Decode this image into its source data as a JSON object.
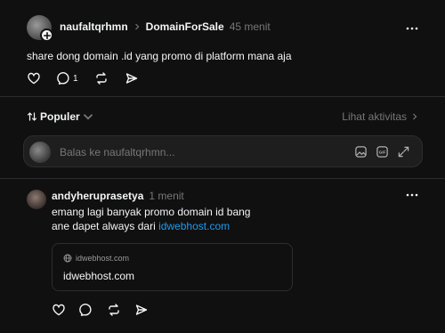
{
  "post": {
    "username": "naufaltqrhmn",
    "community": "DomainForSale",
    "time": "45 menit",
    "text": "share dong domain .id yang promo di platform mana aja",
    "reply_count": "1"
  },
  "sort": {
    "label": "Populer",
    "activity_label": "Lihat aktivitas"
  },
  "reply_box": {
    "placeholder": "Balas ke naufaltqrhmn..."
  },
  "comment": {
    "username": "andyheruprasetya",
    "time": "1 menit",
    "line1": "emang lagi banyak promo domain id bang",
    "line2_prefix": "ane dapet always dari ",
    "link": "idwebhost.com",
    "card": {
      "domain": "idwebhost.com",
      "title": "idwebhost.com"
    }
  },
  "colors": {
    "background": "#101010",
    "text": "#f3f5f7",
    "muted": "#777777",
    "link": "#1c9bef",
    "border": "#2d2d2d"
  }
}
